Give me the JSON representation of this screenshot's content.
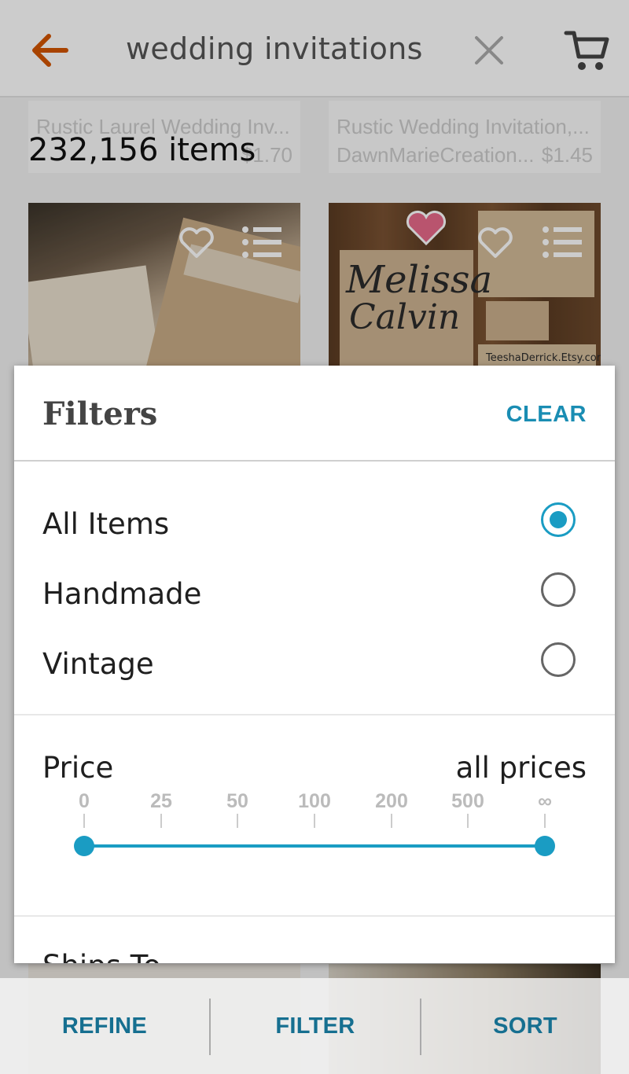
{
  "header": {
    "search_query": "wedding invitations",
    "back_icon": "back-arrow-icon",
    "clear_icon": "close-icon",
    "cart_icon": "cart-icon",
    "accent_color": "#d35400"
  },
  "results": {
    "count_label": "232,156 items",
    "ghost_cards": [
      {
        "title": "Rustic Laurel Wedding Inv...",
        "shop": "",
        "price": "$1.70"
      },
      {
        "title": "Rustic Wedding Invitation,...",
        "shop": "DawnMarieCreation...",
        "price": "$1.45"
      }
    ],
    "listing_2_watermark": "TeeshaDerrick.Etsy.com"
  },
  "filters": {
    "title": "Filters",
    "clear_label": "CLEAR",
    "options": [
      {
        "label": "All Items",
        "selected": true
      },
      {
        "label": "Handmade",
        "selected": false
      },
      {
        "label": "Vintage",
        "selected": false
      }
    ],
    "price": {
      "label": "Price",
      "value_label": "all prices",
      "ticks": [
        "0",
        "25",
        "50",
        "100",
        "200",
        "500",
        "∞"
      ],
      "range_min": "0",
      "range_max": "∞"
    },
    "ships_to_label": "Ships To",
    "accent_color": "#1a9cc3"
  },
  "bottom_bar": {
    "refine_label": "REFINE",
    "filter_label": "FILTER",
    "sort_label": "SORT"
  }
}
